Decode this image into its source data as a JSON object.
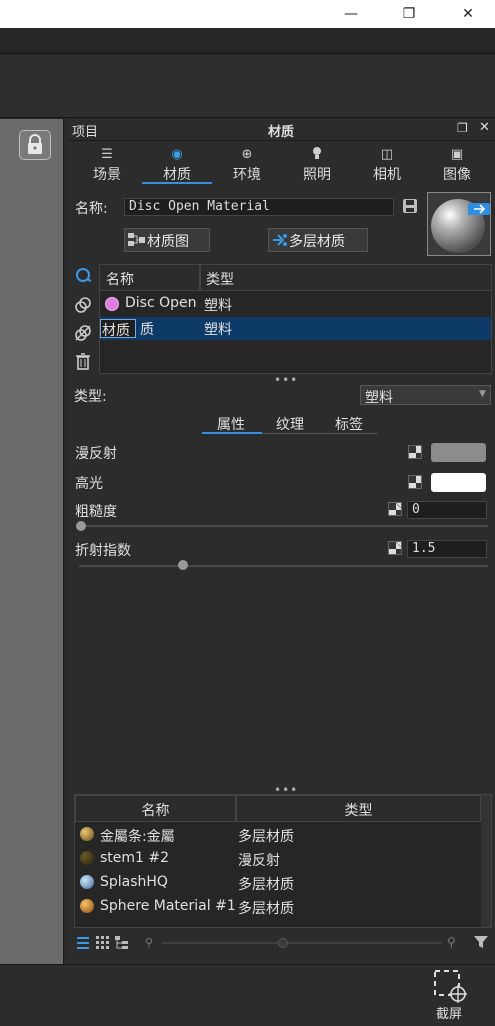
{
  "window": {
    "minimize_glyph": "—",
    "maximize_glyph": "❐",
    "close_glyph": "✕"
  },
  "panel": {
    "left_title": "项目",
    "title": "材质",
    "float_glyph": "❐",
    "close_glyph": "✕",
    "tabs": [
      {
        "label": "场景",
        "icon": "list-icon",
        "glyph": "☰"
      },
      {
        "label": "材质",
        "icon": "material-ball-icon",
        "glyph": "◉"
      },
      {
        "label": "环境",
        "icon": "globe-icon",
        "glyph": "⊕"
      },
      {
        "label": "照明",
        "icon": "bulb-icon",
        "glyph": "💡"
      },
      {
        "label": "相机",
        "icon": "camera-icon",
        "glyph": "◫"
      },
      {
        "label": "图像",
        "icon": "image-icon",
        "glyph": "▣"
      }
    ],
    "active_tab": "材质"
  },
  "material": {
    "name_label": "名称:",
    "name_value": "Disc Open Material",
    "graph_button": "材质图",
    "multilayer_button": "多层材质"
  },
  "material_table": {
    "headers": [
      "名称",
      "类型"
    ],
    "rows": [
      {
        "name": "Disc Open",
        "type": "塑料",
        "color": "#e07ee0"
      },
      {
        "name_edit": "材质",
        "name_rest": "质",
        "type": "塑料",
        "selected": true
      }
    ]
  },
  "properties": {
    "type_label": "类型:",
    "type_value": "塑料",
    "subtabs": [
      "属性",
      "纹理",
      "标签"
    ],
    "active_subtab": "属性",
    "diffuse_label": "漫反射",
    "diffuse_color": "#8c8c8c",
    "specular_label": "高光",
    "specular_color": "#ffffff",
    "roughness_label": "粗糙度",
    "roughness_value": "0",
    "roughness_fraction": 0.0,
    "ior_label": "折射指数",
    "ior_value": "1.5",
    "ior_fraction": 0.25
  },
  "library": {
    "headers": [
      "名称",
      "类型"
    ],
    "rows": [
      {
        "name": "金屬条:金屬",
        "type": "多层材质",
        "color": "#b08a3a"
      },
      {
        "name": "stem1  #2",
        "type": "漫反射",
        "color": "#3a3216"
      },
      {
        "name": "SplashHQ",
        "type": "多层材质",
        "color": "#6aa0c8"
      },
      {
        "name": "Sphere Material #1",
        "type": "多层材质",
        "color": "#d08a2a"
      }
    ]
  },
  "bottom": {
    "screenshot_label": "截屏"
  }
}
